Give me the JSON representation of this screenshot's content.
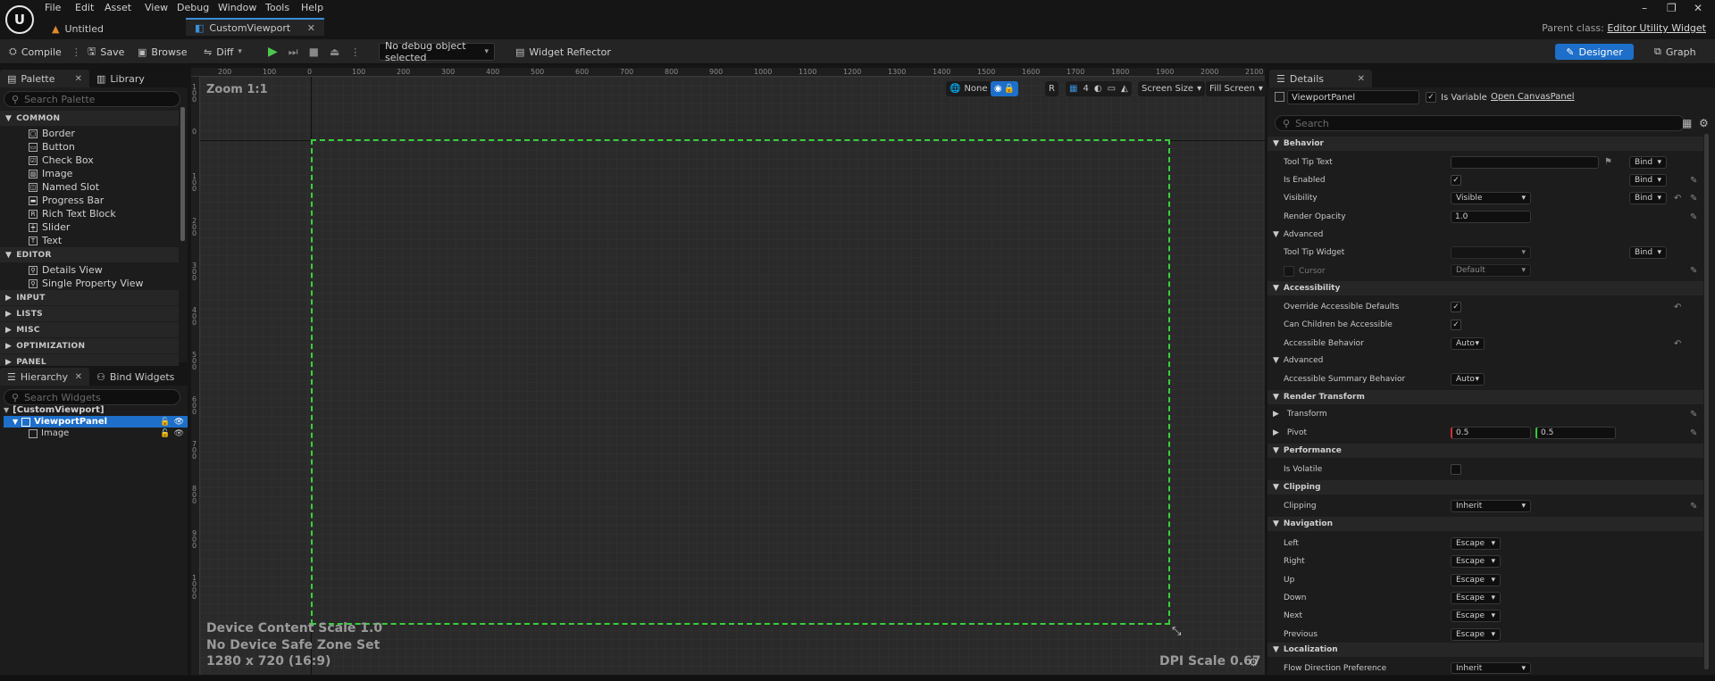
{
  "menu": [
    "File",
    "Edit",
    "Asset",
    "View",
    "Debug",
    "Window",
    "Tools",
    "Help"
  ],
  "window_controls": [
    "–",
    "❐",
    "✕"
  ],
  "tabs": [
    {
      "label": "Untitled",
      "active": false
    },
    {
      "label": "CustomViewport",
      "active": true
    }
  ],
  "parent_class": {
    "label": "Parent class:",
    "value": "Editor Utility Widget"
  },
  "toolbar": {
    "compile": "Compile",
    "save": "Save",
    "browse": "Browse",
    "diff": "Diff",
    "debug_object": "No debug object selected",
    "widget_reflector": "Widget Reflector",
    "designer": "Designer",
    "graph": "Graph"
  },
  "palette": {
    "tab": "Palette",
    "library_tab": "Library",
    "search_placeholder": "Search Palette",
    "categories": [
      {
        "name": "COMMON",
        "expanded": true,
        "items": [
          "Border",
          "Button",
          "Check Box",
          "Image",
          "Named Slot",
          "Progress Bar",
          "Rich Text Block",
          "Slider",
          "Text"
        ]
      },
      {
        "name": "EDITOR",
        "expanded": true,
        "items": [
          "Details View",
          "Single Property View"
        ]
      },
      {
        "name": "INPUT",
        "expanded": false,
        "items": []
      },
      {
        "name": "LISTS",
        "expanded": false,
        "items": []
      },
      {
        "name": "MISC",
        "expanded": false,
        "items": []
      },
      {
        "name": "OPTIMIZATION",
        "expanded": false,
        "items": []
      },
      {
        "name": "PANEL",
        "expanded": false,
        "items": []
      }
    ]
  },
  "hierarchy": {
    "tab": "Hierarchy",
    "bind_tab": "Bind Widgets",
    "search_placeholder": "Search Widgets",
    "root": "[CustomViewport]",
    "selected": "ViewportPanel",
    "child": "Image"
  },
  "canvas": {
    "zoom": "Zoom 1:1",
    "ruler_top": [
      "200",
      "100",
      "0",
      "100",
      "200",
      "300",
      "400",
      "500",
      "600",
      "700",
      "800",
      "900",
      "1000",
      "1100",
      "1200",
      "1300",
      "1400",
      "1500",
      "1600",
      "1700",
      "1800",
      "1900",
      "2000",
      "2100"
    ],
    "ruler_left": [
      "100",
      "0",
      "100",
      "200",
      "300",
      "400",
      "500",
      "600",
      "700",
      "800",
      "900",
      "1000"
    ],
    "toolbar": {
      "none": "None",
      "r": "R",
      "grid": "4",
      "screen_size": "Screen Size",
      "fill_screen": "Fill Screen"
    },
    "device_content_scale": "Device Content Scale 1.0",
    "safe_zone": "No Device Safe Zone Set",
    "resolution": "1280 x 720 (16:9)",
    "dpi_scale": "DPI Scale 0.67"
  },
  "details": {
    "tab": "Details",
    "widget_name": "ViewportPanel",
    "is_variable": "Is Variable",
    "open_link": "Open CanvasPanel",
    "search_placeholder": "Search",
    "bind": "Bind",
    "behavior": {
      "title": "Behavior",
      "tool_tip_text": "Tool Tip Text",
      "is_enabled": "Is Enabled",
      "visibility": "Visibility",
      "visibility_value": "Visible",
      "render_opacity": "Render Opacity",
      "render_opacity_value": "1.0",
      "advanced": "Advanced",
      "tool_tip_widget": "Tool Tip Widget",
      "cursor": "Cursor",
      "cursor_value": "Default"
    },
    "accessibility": {
      "title": "Accessibility",
      "override": "Override Accessible Defaults",
      "can_children": "Can Children be Accessible",
      "behavior": "Accessible Behavior",
      "behavior_value": "Auto",
      "advanced": "Advanced",
      "summary": "Accessible Summary Behavior",
      "summary_value": "Auto"
    },
    "render_transform": {
      "title": "Render Transform",
      "transform": "Transform",
      "pivot": "Pivot",
      "pivot_x": "0.5",
      "pivot_y": "0.5"
    },
    "performance": {
      "title": "Performance",
      "is_volatile": "Is Volatile"
    },
    "clipping": {
      "title": "Clipping",
      "label": "Clipping",
      "value": "Inherit"
    },
    "navigation": {
      "title": "Navigation",
      "rows": [
        {
          "label": "Left",
          "value": "Escape"
        },
        {
          "label": "Right",
          "value": "Escape"
        },
        {
          "label": "Up",
          "value": "Escape"
        },
        {
          "label": "Down",
          "value": "Escape"
        },
        {
          "label": "Next",
          "value": "Escape"
        },
        {
          "label": "Previous",
          "value": "Escape"
        }
      ]
    },
    "localization": {
      "title": "Localization",
      "flow": "Flow Direction Preference",
      "flow_value": "Inherit"
    }
  }
}
